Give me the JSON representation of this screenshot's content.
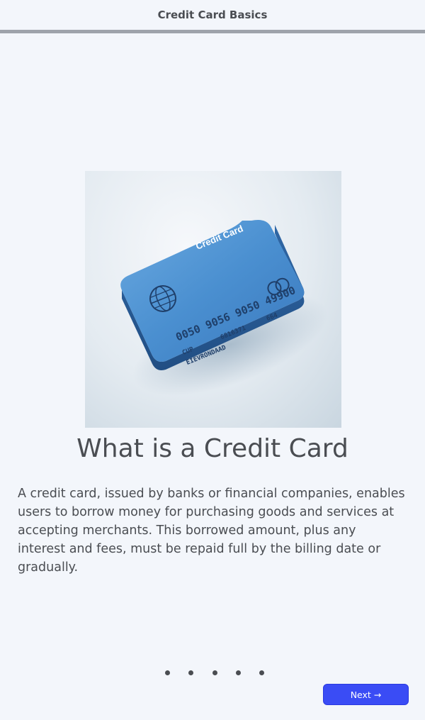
{
  "header": {
    "title": "Credit Card Basics"
  },
  "progress": {
    "fraction": 1.0
  },
  "slide": {
    "image_alt": "credit-card-illustration",
    "card_text": {
      "brand": "Credit Card",
      "number": "0050 9056 9050 49900",
      "line2_left": "CUP",
      "line2_mid": "6816371",
      "line2_right": "664",
      "holder": "EIEVRONDAAD"
    },
    "title": "What is a Credit Card",
    "body": "A credit card, issued by banks or financial companies, enables users to borrow money for purchasing goods and services at accepting merchants. This borrowed amount, plus any interest and fees, must be repaid full by the billing date or gradually."
  },
  "pagination": {
    "count": 5
  },
  "footer": {
    "next_label": "Next →"
  },
  "colors": {
    "accent": "#3a4cf5",
    "card_blue": "#4a8fd0",
    "text": "#4a4d52"
  }
}
